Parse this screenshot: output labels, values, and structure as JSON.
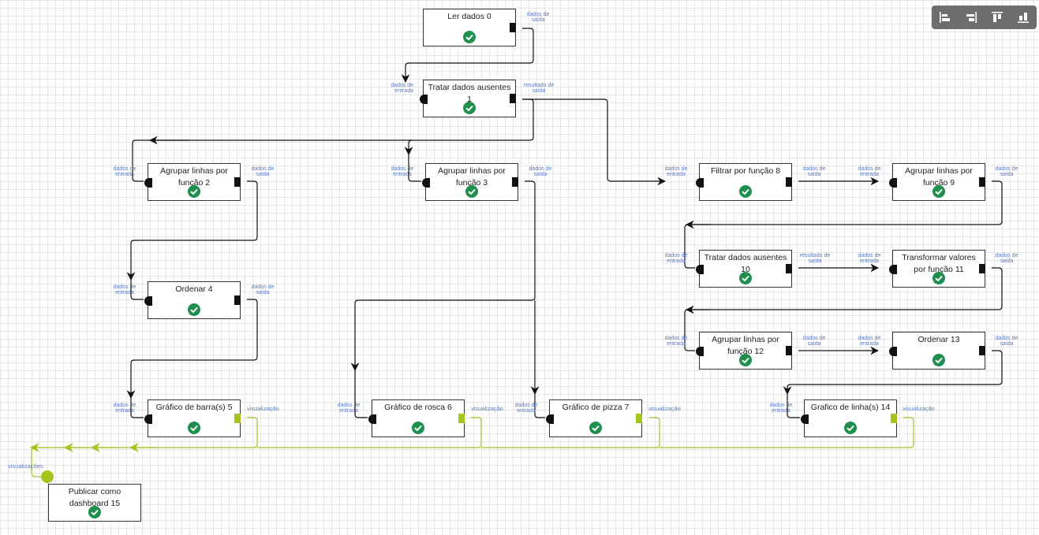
{
  "toolbar": {
    "buttons": [
      {
        "name": "align-left-icon"
      },
      {
        "name": "align-right-icon"
      },
      {
        "name": "align-top-icon"
      },
      {
        "name": "align-bottom-icon"
      }
    ]
  },
  "nodes": [
    {
      "id": "n0",
      "label": "Ler dados 0"
    },
    {
      "id": "n1",
      "label": "Tratar dados ausentes 1"
    },
    {
      "id": "n2",
      "label": "Agrupar linhas por função 2"
    },
    {
      "id": "n3",
      "label": "Agrupar linhas por função 3"
    },
    {
      "id": "n4",
      "label": "Ordenar 4"
    },
    {
      "id": "n5",
      "label": "Gráfico de barra(s) 5"
    },
    {
      "id": "n6",
      "label": "Gráfico de rosca 6"
    },
    {
      "id": "n7",
      "label": "Gráfico de pizza 7"
    },
    {
      "id": "n8",
      "label": "Filtrar por função 8"
    },
    {
      "id": "n9",
      "label": "Agrupar linhas por função 9"
    },
    {
      "id": "n10",
      "label": "Tratar dados ausentes 10"
    },
    {
      "id": "n11",
      "label": "Transformar valores por função 11"
    },
    {
      "id": "n12",
      "label": "Agrupar linhas por função 12"
    },
    {
      "id": "n13",
      "label": "Ordenar 13"
    },
    {
      "id": "n14",
      "label": "Grafico de linha(s) 14"
    },
    {
      "id": "n15",
      "label": "Publicar como dashboard 15"
    }
  ],
  "ports": {
    "input": "dados de entrada",
    "output": "dados de saída",
    "result": "resultado de saída",
    "viz": "visualização",
    "vizs": "visualizações"
  },
  "colors": {
    "wire": "#111111",
    "viz_wire": "#a4c520",
    "success": "#1f8f4e",
    "port_label": "#5c7ac7"
  }
}
